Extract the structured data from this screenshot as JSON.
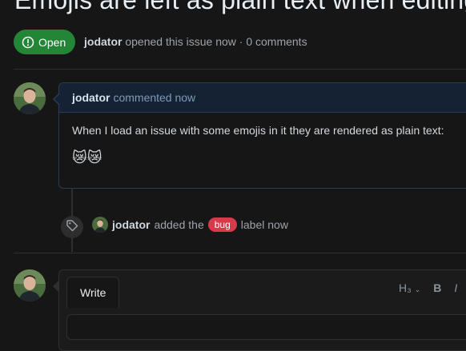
{
  "issue": {
    "title": "Emojis are left as plain text when editing",
    "state_label": "Open",
    "author": "jodator",
    "meta_rest": "opened this issue now · 0 comments"
  },
  "comment": {
    "author": "jodator",
    "header_rest": "commented now",
    "body": "When I load an issue with some emojis in it they are rendered as plain text:",
    "emojis": "😿😿"
  },
  "event": {
    "actor": "jodator",
    "action": "added the",
    "label": "bug",
    "suffix": "label now"
  },
  "editor": {
    "tab_write": "Write",
    "heading_btn": "H₃",
    "bold_btn": "B"
  },
  "colors": {
    "open": "#238636",
    "bug_label": "#d73a4a",
    "comment_header": "#152234"
  }
}
